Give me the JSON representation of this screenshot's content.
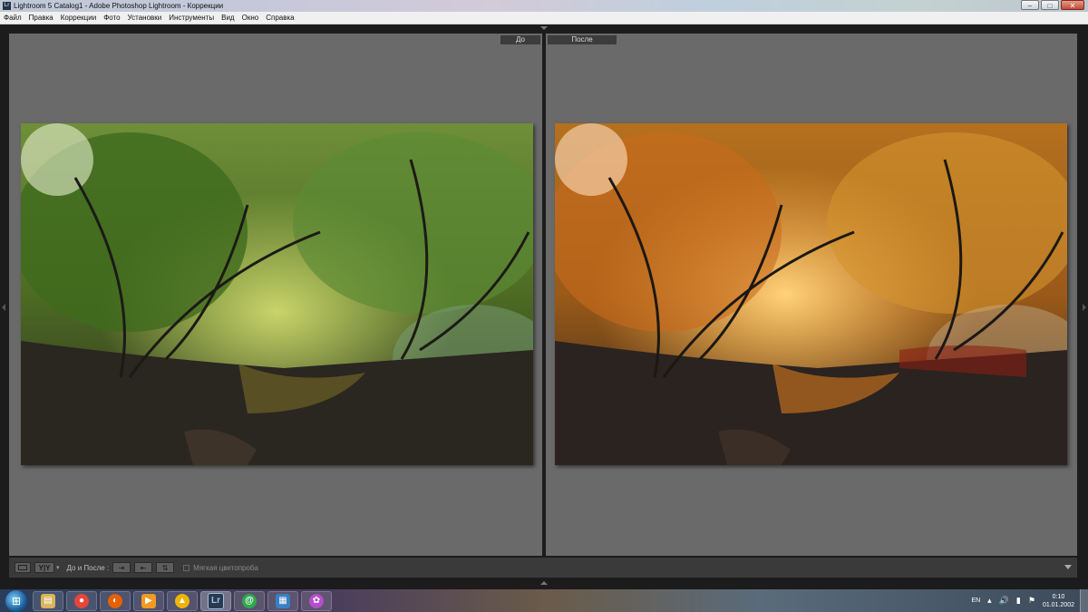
{
  "window": {
    "app_icon": "Lr",
    "title": "Lightroom 5 Catalog1 - Adobe Photoshop Lightroom - Коррекции",
    "minimize": "–",
    "maximize": "□",
    "close": "✕"
  },
  "menu": [
    "Файл",
    "Правка",
    "Коррекции",
    "Фото",
    "Установки",
    "Инструменты",
    "Вид",
    "Окно",
    "Справка"
  ],
  "view": {
    "before_label": "До",
    "after_label": "После"
  },
  "toolbar": {
    "yy_label": "Y|Y",
    "before_after_label": "До и После :",
    "soft_proofing_label": "Мягкая цветопроба",
    "soft_proofing_checked": false
  },
  "taskbar": {
    "apps": [
      {
        "name": "explorer",
        "icon": "folder-icon",
        "color": "#d9b45a"
      },
      {
        "name": "chrome",
        "icon": "chrome-icon",
        "color": "#e8453c"
      },
      {
        "name": "firefox",
        "icon": "firefox-icon",
        "color": "#e66000"
      },
      {
        "name": "media-player",
        "icon": "play-icon",
        "color": "#f39a21"
      },
      {
        "name": "aimp",
        "icon": "aimp-icon",
        "color": "#f0b400"
      },
      {
        "name": "lightroom",
        "icon": "lightroom-icon",
        "label": "Lr",
        "color": "#2a3a4d"
      },
      {
        "name": "mail-agent",
        "icon": "mail-agent-icon",
        "label": "@",
        "color": "#2fa84f"
      },
      {
        "name": "photo-viewer",
        "icon": "photo-viewer-icon",
        "color": "#3a7fc1"
      },
      {
        "name": "picasa",
        "icon": "picasa-icon",
        "color": "#b34fc9"
      }
    ],
    "language": "EN",
    "time": "0:10",
    "date": "01.01.2002"
  }
}
